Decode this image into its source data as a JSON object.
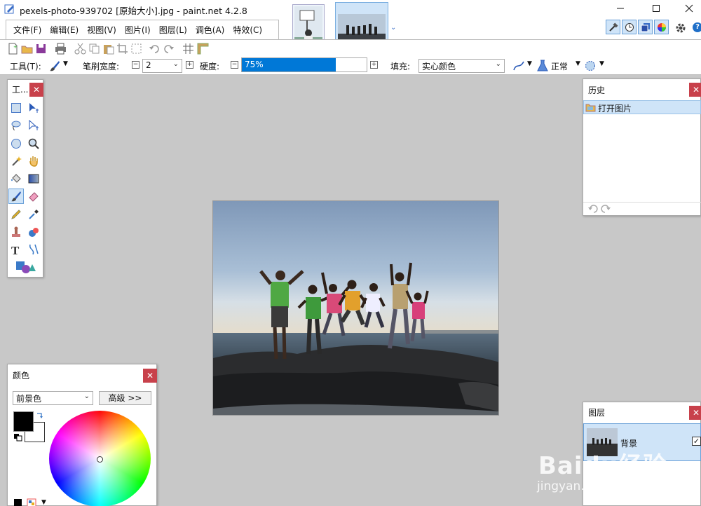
{
  "window": {
    "title": "pexels-photo-939702 [原始大小].jpg - paint.net 4.2.8"
  },
  "menu": {
    "items": [
      "文件(F)",
      "编辑(E)",
      "视图(V)",
      "图片(I)",
      "图层(L)",
      "调色(A)",
      "特效(C)"
    ]
  },
  "toolbar": {
    "tool_label": "工具(T):",
    "brush_width_label": "笔刷宽度:",
    "brush_width_value": "2",
    "hardness_label": "硬度:",
    "hardness_value": "75%",
    "hardness_fraction": 0.75,
    "fill_label": "填充:",
    "fill_value": "实心颜色",
    "blend_mode": "正常"
  },
  "tools_panel": {
    "title": "工..."
  },
  "history_panel": {
    "title": "历史",
    "items": [
      "打开图片"
    ]
  },
  "colors_panel": {
    "title": "颜色",
    "mode": "前景色",
    "advanced_label": "高级 >>",
    "primary_color": "#000000",
    "secondary_color": "#ffffff"
  },
  "layers_panel": {
    "title": "图层",
    "layers": [
      {
        "name": "背景",
        "visible": true
      }
    ]
  },
  "watermark": {
    "text": "Baidu经验",
    "url": "jingyan.baidu.com"
  },
  "colors": {
    "accent": "#0078d7",
    "selection": "#cfe4f8",
    "close": "#c8414b",
    "workspace": "#c8c8c8"
  }
}
